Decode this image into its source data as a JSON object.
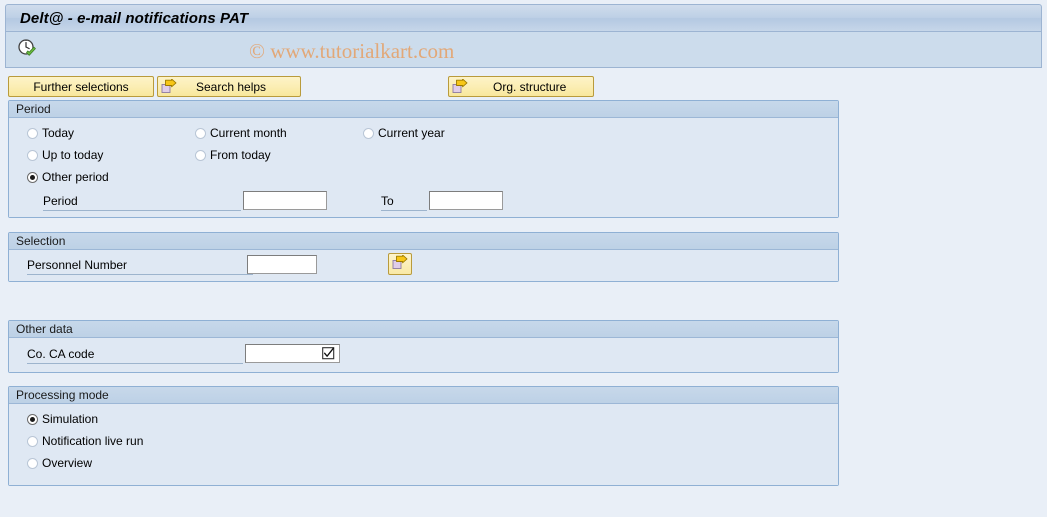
{
  "window": {
    "title": "Delt@ - e-mail notifications PAT"
  },
  "toolbar": {
    "execute_icon": "clock-check-execute-icon",
    "watermark": "© www.tutorialkart.com"
  },
  "buttons": [
    {
      "label": "Further selections",
      "icon": null,
      "name": "further-selections-button"
    },
    {
      "label": "Search helps",
      "icon": "arrow-right-icon",
      "name": "search-helps-button"
    },
    {
      "label": "Org. structure",
      "icon": "arrow-right-icon",
      "name": "org-structure-button"
    }
  ],
  "period": {
    "header": "Period",
    "options": [
      {
        "label": "Today",
        "selected": false
      },
      {
        "label": "Current month",
        "selected": false
      },
      {
        "label": "Current year",
        "selected": false
      },
      {
        "label": "Up to today",
        "selected": false
      },
      {
        "label": "From today",
        "selected": false
      },
      {
        "label": "Other period",
        "selected": true
      }
    ],
    "period_label": "Period",
    "period_value": "",
    "period_placeholder": "",
    "to_label": "To",
    "to_value": "",
    "to_placeholder": ""
  },
  "selection": {
    "header": "Selection",
    "personnel_label": "Personnel Number",
    "personnel_value": "",
    "personnel_placeholder": "",
    "multi_select_icon": "arrow-right-multi-select-icon"
  },
  "other_data": {
    "header": "Other data",
    "ca_code_label": "Co. CA code",
    "ca_code_value": "",
    "ca_code_placeholder": "",
    "value_help_icon": "checkbox-check-value-help-icon"
  },
  "processing_mode": {
    "header": "Processing mode",
    "options": [
      {
        "label": "Simulation",
        "selected": true
      },
      {
        "label": "Notification live run",
        "selected": false
      },
      {
        "label": "Overview",
        "selected": false
      }
    ]
  },
  "colors": {
    "page_background": "#e9eff7",
    "panel_background": "#dfe8f3",
    "panel_border": "#8fb0d4",
    "title_bar": "#bed0e6",
    "button_yellow": "#fbeeb4",
    "button_border": "#b99b3c",
    "watermark": "#e2a878",
    "icon_arrow_yellow": "#f5c518",
    "icon_check_green": "#5fae3a"
  }
}
